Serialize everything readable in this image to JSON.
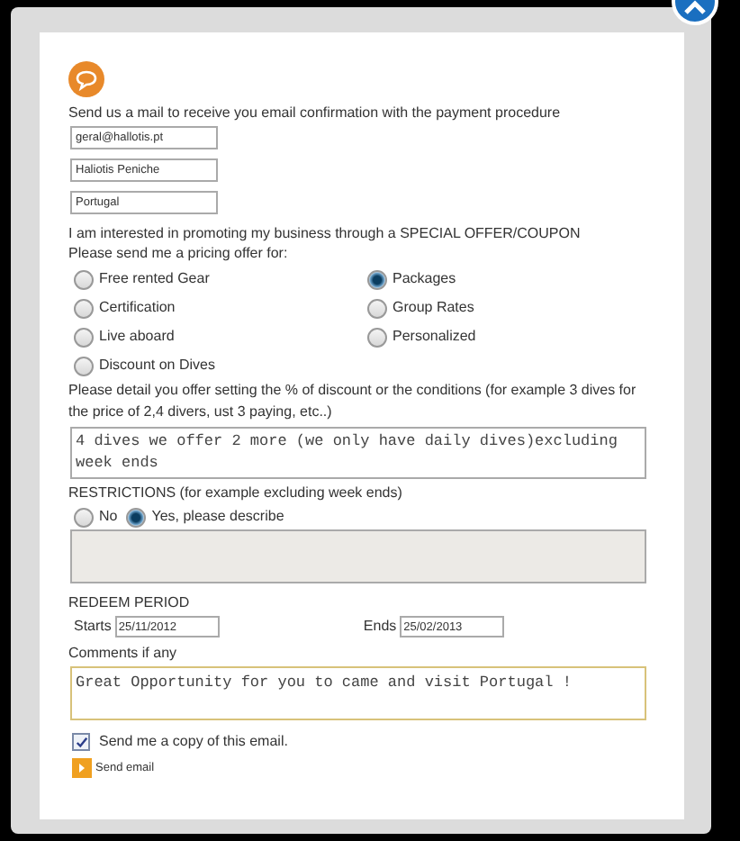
{
  "intro": "Send us a mail to receive you email confirmation with the payment procedure",
  "fields": [
    {
      "value": "geral@hallotis.pt"
    },
    {
      "value": "Haliotis Peniche"
    },
    {
      "value": "Portugal"
    }
  ],
  "interest": "I am interested in promoting my business through a SPECIAL OFFER/COUPON",
  "offer_label": "Please send me a pricing offer for:",
  "offers": [
    {
      "label": "Free rented Gear",
      "selected": false
    },
    {
      "label": "Packages",
      "selected": true
    },
    {
      "label": "Certification",
      "selected": false
    },
    {
      "label": "Group Rates",
      "selected": false
    },
    {
      "label": "Live aboard",
      "selected": false
    },
    {
      "label": "Personalized",
      "selected": false
    },
    {
      "label": "Discount on Dives",
      "selected": false
    }
  ],
  "detail_label": "Please detail you offer setting the % of discount or the conditions (for example 3 dives for the price of 2,4 divers, ust 3 paying, etc..)",
  "detail_value": "4 dives we offer 2 more (we only have daily dives)excluding week ends",
  "restrictions_label": "RESTRICTIONS (for example excluding week ends)",
  "restriction_options": [
    {
      "label": "No",
      "selected": false
    },
    {
      "label": "Yes, please describe",
      "selected": true
    }
  ],
  "redeem_label": "REDEEM PERIOD",
  "starts": {
    "label": "Starts",
    "value": "25/11/2012"
  },
  "ends": {
    "label": "Ends",
    "value": "25/02/2013"
  },
  "comments_label": "Comments if any",
  "comments_value": "Great Opportunity for you to came and visit Portugal !",
  "copy": {
    "label": "Send me a copy of this email.",
    "checked": true
  },
  "send_button": "Send email"
}
